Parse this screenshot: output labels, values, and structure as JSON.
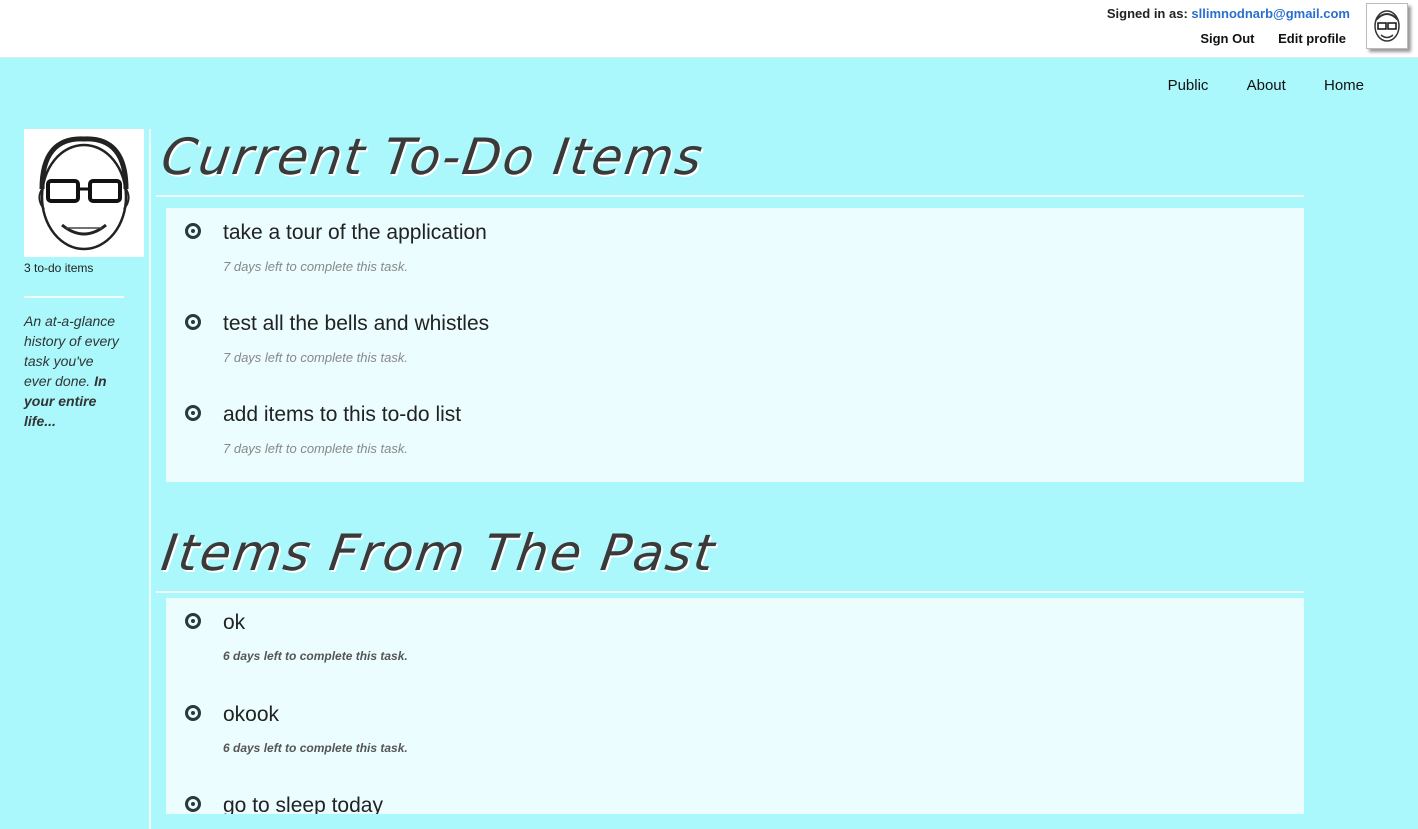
{
  "header": {
    "signed_in_label": "Signed in as:",
    "email": "sllimnodnarb@gmail.com",
    "sign_out": "Sign Out",
    "edit_profile": "Edit profile"
  },
  "nav": [
    "Public",
    "About",
    "Home"
  ],
  "sidebar": {
    "todo_count": "3 to-do items",
    "tagline_italic": "An at-a-glance history of every task you've ever done.",
    "tagline_bold": "In your entire life..."
  },
  "current": {
    "title": "Current To-Do Items",
    "items": [
      {
        "title": "take a tour of the application",
        "due": "7 days left to complete this task."
      },
      {
        "title": "test all the bells and whistles",
        "due": "7 days left to complete this task."
      },
      {
        "title": "add items to this to-do list",
        "due": "7 days left to complete this task."
      }
    ]
  },
  "past": {
    "title": "Items From The Past",
    "items": [
      {
        "title": "ok",
        "due": "6 days left to complete this task."
      },
      {
        "title": "okook",
        "due": "6 days left to complete this task."
      },
      {
        "title": "go to sleep today",
        "due": ""
      }
    ]
  },
  "colors": {
    "background": "#aaf8fb",
    "panel": "#ebfdfe",
    "link": "#2a6fd0"
  },
  "icons": [
    "radio-target-icon",
    "avatar-sketch-icon"
  ]
}
